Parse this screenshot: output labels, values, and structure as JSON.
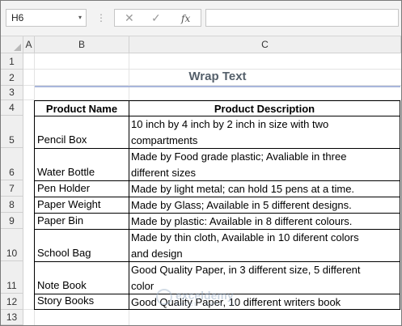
{
  "formula_bar": {
    "name_box": "H6",
    "name_dropdown_glyph": "▾",
    "separator": "⋮",
    "cancel_glyph": "✕",
    "enter_glyph": "✓",
    "function_label": "fx",
    "formula": ""
  },
  "columns": [
    "A",
    "B",
    "C"
  ],
  "rows": [
    "1",
    "2",
    "3",
    "4",
    "5",
    "6",
    "7",
    "8",
    "9",
    "10",
    "11",
    "12",
    "13"
  ],
  "sheet": {
    "title": "Wrap Text",
    "headers": [
      "Product Name",
      "Product Description"
    ],
    "items": [
      {
        "name": "Pencil Box",
        "desc1": "10 inch by 4 inch by 2 inch in size with two",
        "desc2": "compartments"
      },
      {
        "name": "Water Bottle",
        "desc1": "Made by Food grade plastic; Avaliable in three",
        "desc2": "different sizes"
      },
      {
        "name": "Pen Holder",
        "desc1": "Made by light metal; can hold 15 pens at a time.",
        "desc2": ""
      },
      {
        "name": "Paper Weight",
        "desc1": "Made by Glass; Available in 5 different designs.",
        "desc2": ""
      },
      {
        "name": "Paper Bin",
        "desc1": "Made by plastic: Available in 8 different colours.",
        "desc2": ""
      },
      {
        "name": "School Bag",
        "desc1": "Made by thin cloth, Available in 10 diferent colors",
        "desc2": "and design"
      },
      {
        "name": "Note Book",
        "desc1": "Good Quality Paper, in 3 different size, 5 different",
        "desc2": "color"
      },
      {
        "name": "Story Books",
        "desc1": "Good Quality Paper, 10 different writers book",
        "desc2": ""
      }
    ]
  },
  "watermark": {
    "brand": "exceldemy",
    "tagline": "EXCEL · DATA · BI"
  },
  "colors": {
    "title": "#55606b",
    "title_underline": "#a9b6db",
    "header_bg": "#efefef"
  }
}
